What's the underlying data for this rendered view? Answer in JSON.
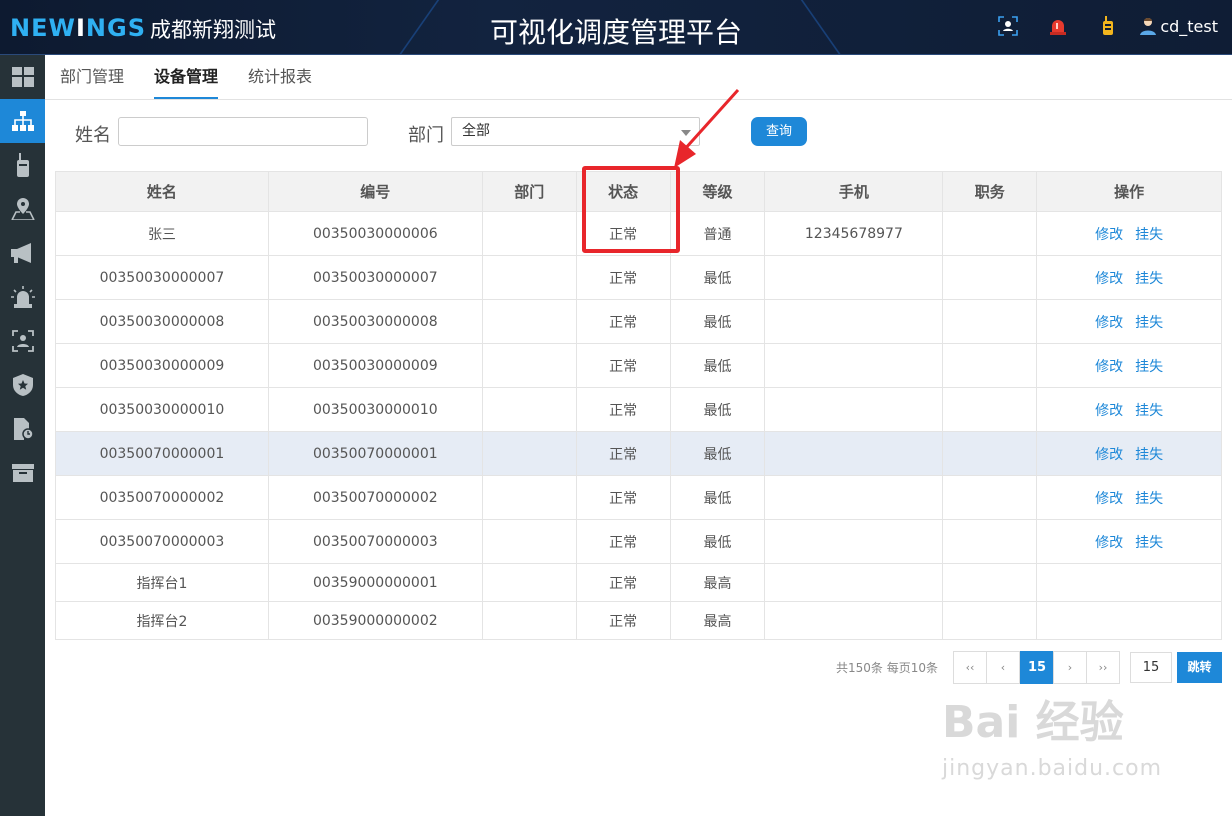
{
  "header": {
    "logo": "NEWINGS",
    "company": "成都新翔测试",
    "title": "可视化调度管理平台",
    "username": "cd_test"
  },
  "tabs": [
    "部门管理",
    "设备管理",
    "统计报表"
  ],
  "search": {
    "name_label": "姓名",
    "name_value": "",
    "dept_label": "部门",
    "dept_value": "全部",
    "query_button": "查询"
  },
  "table": {
    "headers": [
      "姓名",
      "编号",
      "部门",
      "状态",
      "等级",
      "手机",
      "职务",
      "操作"
    ],
    "rows": [
      {
        "name": "张三",
        "code": "00350030000006",
        "dept": "",
        "status": "正常",
        "level": "普通",
        "phone": "12345678977",
        "title": "",
        "edit": "修改",
        "lost": "挂失"
      },
      {
        "name": "00350030000007",
        "code": "00350030000007",
        "dept": "",
        "status": "正常",
        "level": "最低",
        "phone": "",
        "title": "",
        "edit": "修改",
        "lost": "挂失"
      },
      {
        "name": "00350030000008",
        "code": "00350030000008",
        "dept": "",
        "status": "正常",
        "level": "最低",
        "phone": "",
        "title": "",
        "edit": "修改",
        "lost": "挂失"
      },
      {
        "name": "00350030000009",
        "code": "00350030000009",
        "dept": "",
        "status": "正常",
        "level": "最低",
        "phone": "",
        "title": "",
        "edit": "修改",
        "lost": "挂失"
      },
      {
        "name": "00350030000010",
        "code": "00350030000010",
        "dept": "",
        "status": "正常",
        "level": "最低",
        "phone": "",
        "title": "",
        "edit": "修改",
        "lost": "挂失"
      },
      {
        "name": "00350070000001",
        "code": "00350070000001",
        "dept": "",
        "status": "正常",
        "level": "最低",
        "phone": "",
        "title": "",
        "edit": "修改",
        "lost": "挂失"
      },
      {
        "name": "00350070000002",
        "code": "00350070000002",
        "dept": "",
        "status": "正常",
        "level": "最低",
        "phone": "",
        "title": "",
        "edit": "修改",
        "lost": "挂失"
      },
      {
        "name": "00350070000003",
        "code": "00350070000003",
        "dept": "",
        "status": "正常",
        "level": "最低",
        "phone": "",
        "title": "",
        "edit": "修改",
        "lost": "挂失"
      },
      {
        "name": "指挥台1",
        "code": "00359000000001",
        "dept": "",
        "status": "正常",
        "level": "最高",
        "phone": "",
        "title": "",
        "edit": "",
        "lost": ""
      },
      {
        "name": "指挥台2",
        "code": "00359000000002",
        "dept": "",
        "status": "正常",
        "level": "最高",
        "phone": "",
        "title": "",
        "edit": "",
        "lost": ""
      }
    ]
  },
  "pager": {
    "total_text": "共150条 每页10条",
    "first": "‹‹",
    "prev": "‹",
    "current": "15",
    "next": "›",
    "last": "››",
    "jump_value": "15",
    "jump_button": "跳转"
  },
  "watermark": {
    "brand": "Bai 经验",
    "url": "jingyan.baidu.com"
  },
  "colors": {
    "accent": "#1e88d8",
    "sidebar": "#263238",
    "annotation": "#e8262b"
  }
}
